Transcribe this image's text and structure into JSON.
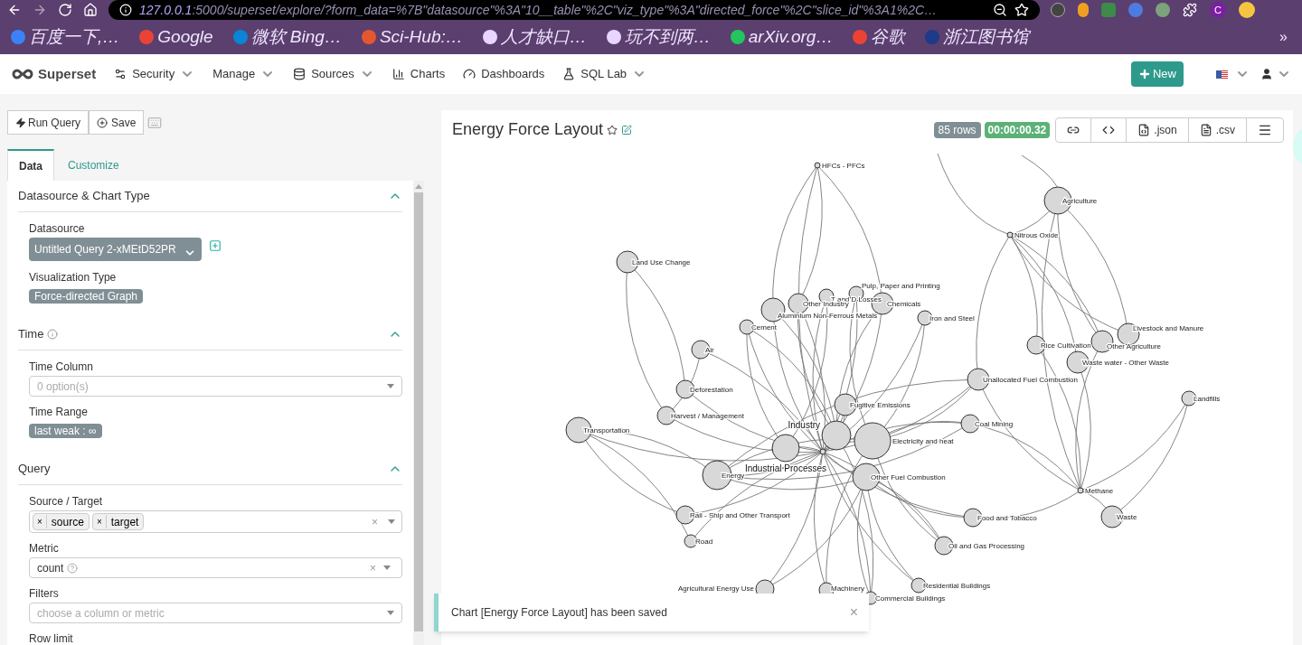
{
  "browser": {
    "url_host": "127.0.0.1",
    "url_rest": ":5000/superset/explore/?form_data=%7B\"datasource\"%3A\"10__table\"%2C\"viz_type\"%3A\"directed_force\"%2C\"slice_id\"%3A1%2C…",
    "bookmarks": [
      {
        "label": "百度一下,…",
        "color": "#3b82f6"
      },
      {
        "label": "Google",
        "color": "#ea4335"
      },
      {
        "label": "微软 Bing…",
        "color": "#0a84d6"
      },
      {
        "label": "Sci-Hub:…",
        "color": "#e4572e"
      },
      {
        "label": "人才缺口…",
        "color": "#e9d5ff"
      },
      {
        "label": "玩不到两…",
        "color": "#e9d5ff"
      },
      {
        "label": "arXiv.org…",
        "color": "#22c55e"
      },
      {
        "label": "谷歌",
        "color": "#ea4335"
      },
      {
        "label": "浙江图书馆",
        "color": "#1e3a8a"
      }
    ],
    "more": "»",
    "profile": "C"
  },
  "navbar": {
    "brand": "Superset",
    "menu": [
      {
        "label": "Security",
        "kind": "security",
        "dropdown": true
      },
      {
        "label": "Manage",
        "kind": "none",
        "dropdown": true
      },
      {
        "label": "Sources",
        "kind": "sources",
        "dropdown": true
      },
      {
        "label": "Charts",
        "kind": "charts",
        "dropdown": false
      },
      {
        "label": "Dashboards",
        "kind": "dashboards",
        "dropdown": false
      },
      {
        "label": "SQL Lab",
        "kind": "sqllab",
        "dropdown": true
      }
    ],
    "new_button": "New"
  },
  "toolbar": {
    "run_query": "Run Query",
    "save": "Save"
  },
  "tabs": [
    {
      "label": "Data",
      "selected": true
    },
    {
      "label": "Customize",
      "selected": false
    }
  ],
  "sections": [
    {
      "title": "Datasource & Chart Type",
      "info": false,
      "expanded": true,
      "fields": [
        {
          "kind": "datasource",
          "label": "Datasource",
          "value": "Untitled Query 2-xMEtD52PR"
        },
        {
          "kind": "tag",
          "label": "Visualization Type",
          "value": "Force-directed Graph"
        }
      ]
    },
    {
      "title": "Time",
      "info": true,
      "expanded": true,
      "fields": [
        {
          "kind": "select",
          "label": "Time Column",
          "placeholder": "0 option(s)"
        },
        {
          "kind": "tag",
          "label": "Time Range",
          "value": "last weak : ∞"
        }
      ]
    },
    {
      "title": "Query",
      "info": false,
      "expanded": true,
      "fields": [
        {
          "kind": "multi",
          "label": "Source / Target",
          "tags": [
            {
              "remove": "×",
              "label": "source"
            },
            {
              "remove": "×",
              "label": "target"
            }
          ],
          "clear": "×"
        },
        {
          "kind": "metric",
          "label": "Metric",
          "value": "count",
          "clear": "×"
        },
        {
          "kind": "select",
          "label": "Filters",
          "placeholder": "choose a column or metric"
        },
        {
          "kind": "heading",
          "label": "Row limit"
        }
      ]
    }
  ],
  "chart": {
    "title": "Energy Force Layout",
    "rows": "85 rows",
    "timer": "00:00:00.32",
    "actions": [
      {
        "kind": "link"
      },
      {
        "kind": "embed"
      },
      {
        "kind": "json",
        "label": ".json"
      },
      {
        "kind": "csv",
        "label": ".csv"
      },
      {
        "kind": "menu"
      }
    ],
    "nodes": [
      {
        "label": "HFCs - PFCs"
      },
      {
        "label": "Agriculture"
      },
      {
        "label": "Nitrous Oxide"
      },
      {
        "label": "Land Use Change"
      },
      {
        "label": "Pulp, Paper and Printing"
      },
      {
        "label": "T and D Losses"
      },
      {
        "label": "Other Industry"
      },
      {
        "label": "Aluminium Non-Ferrous Metals"
      },
      {
        "label": "Chemicals"
      },
      {
        "label": "Cement"
      },
      {
        "label": "Iron and Steel"
      },
      {
        "label": "Air"
      },
      {
        "label": "Rice Cultivation"
      },
      {
        "label": "Other Agriculture"
      },
      {
        "label": "Livestock and Manure"
      },
      {
        "label": "Waste water - Other Waste"
      },
      {
        "label": "Deforestation"
      },
      {
        "label": "Unallocated Fuel Combustion"
      },
      {
        "label": "Landfills"
      },
      {
        "label": "Fugitive Emissions"
      },
      {
        "label": "Harvest / Management"
      },
      {
        "label": "Coal Mining"
      },
      {
        "label": "Transportation"
      },
      {
        "label": "Industry"
      },
      {
        "label": "Electricity and heat"
      },
      {
        "label": "Industrial Processes"
      },
      {
        "label": "Energy"
      },
      {
        "label": "Other Fuel Combustion"
      },
      {
        "label": "Methane"
      },
      {
        "label": "Rail - Ship and Other Transport"
      },
      {
        "label": "Food and Tobacco"
      },
      {
        "label": "Waste"
      },
      {
        "label": "Road"
      },
      {
        "label": "Oil and Gas Processing"
      },
      {
        "label": "Residential Buildings"
      },
      {
        "label": "Agricultural Energy Use"
      },
      {
        "label": "Machinery"
      },
      {
        "label": "Commercial Buildings"
      }
    ]
  },
  "toast": {
    "message": "Chart [Energy Force Layout] has been saved",
    "close": "×"
  }
}
